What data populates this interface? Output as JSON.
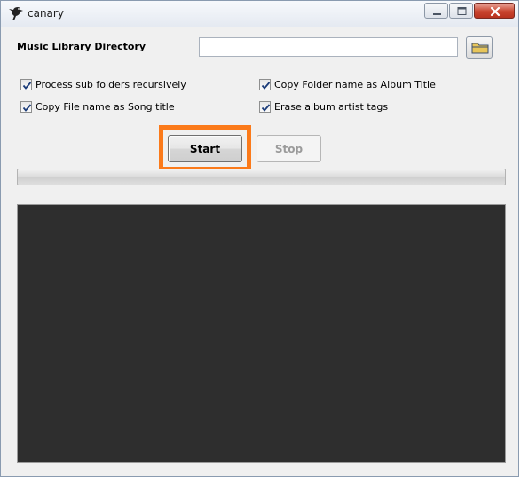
{
  "window": {
    "title": "canary",
    "icon": "canary-bird-icon",
    "controls": {
      "minimize": "minimize-icon",
      "maximize": "maximize-icon",
      "close": "close-icon"
    }
  },
  "music_library": {
    "label": "Music Library Directory",
    "value": "",
    "placeholder": "",
    "browse_icon": "folder-icon"
  },
  "options": [
    {
      "label": "Process sub folders recursively",
      "checked": true
    },
    {
      "label": "Copy Folder name as Album Title",
      "checked": true
    },
    {
      "label": "Copy File name as Song title",
      "checked": true
    },
    {
      "label": "Erase album artist tags",
      "checked": true
    }
  ],
  "actions": {
    "start_label": "Start",
    "stop_label": "Stop",
    "stop_enabled": false
  },
  "progress": {
    "value": 0
  },
  "log": {
    "text": ""
  },
  "colors": {
    "highlight": "#fb7a1a",
    "log_background": "#2e2e2e",
    "window_background": "#f0f0f0"
  }
}
